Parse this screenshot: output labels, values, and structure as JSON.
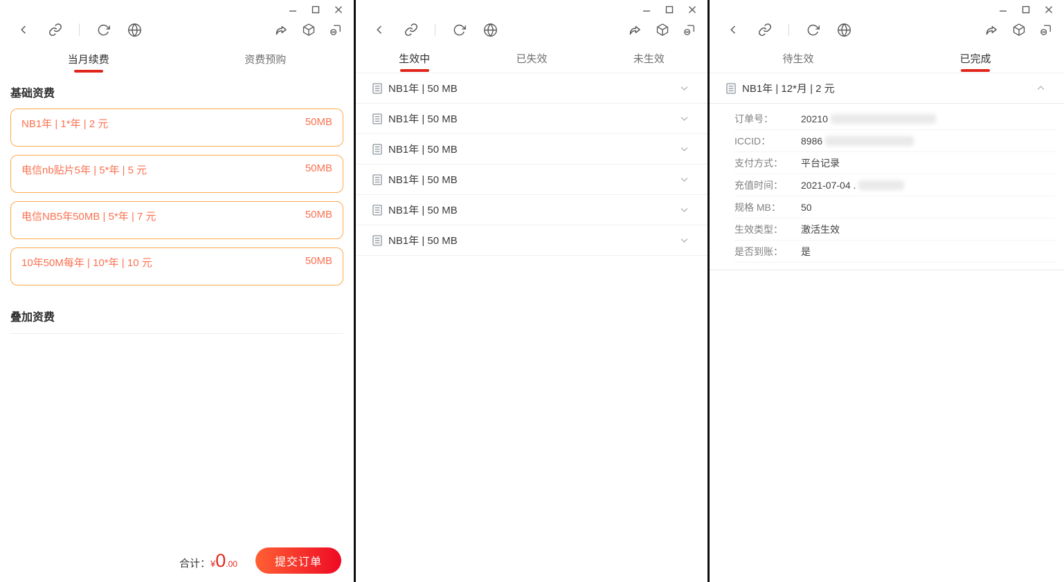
{
  "colors": {
    "accent_red": "#e1251b",
    "card_border": "#fba94c",
    "card_text": "#fb7150",
    "button_gradient": [
      "#ff6034",
      "#ee0a24"
    ]
  },
  "window1": {
    "tabs": [
      {
        "label": "当月续费",
        "active": true
      },
      {
        "label": "资费预购",
        "active": false
      }
    ],
    "basic_section_title": "基础资费",
    "addon_section_title": "叠加资费",
    "plans": [
      {
        "name": "NB1年 | 1*年 | 2 元",
        "size": "50MB"
      },
      {
        "name": "电信nb贴片5年 | 5*年 | 5 元",
        "size": "50MB"
      },
      {
        "name": "电信NB5年50MB | 5*年 | 7 元",
        "size": "50MB"
      },
      {
        "name": "10年50M每年 | 10*年 | 10 元",
        "size": "50MB"
      }
    ],
    "footer": {
      "total_label": "合计：",
      "currency": "¥",
      "amount_int": "0",
      "amount_dec": ".00",
      "submit_label": "提交订单"
    }
  },
  "window2": {
    "tabs": [
      {
        "label": "生效中",
        "active": true
      },
      {
        "label": "已失效",
        "active": false
      },
      {
        "label": "未生效",
        "active": false
      }
    ],
    "items": [
      "NB1年 | 50 MB",
      "NB1年 | 50 MB",
      "NB1年 | 50 MB",
      "NB1年 | 50 MB",
      "NB1年 | 50 MB",
      "NB1年 | 50 MB"
    ]
  },
  "window3": {
    "tabs": [
      {
        "label": "待生效",
        "active": false
      },
      {
        "label": "已完成",
        "active": true
      }
    ],
    "order": {
      "title": "NB1年 | 12*月 | 2 元",
      "details": [
        {
          "label": "订单号：",
          "value": "20210",
          "redacted": true
        },
        {
          "label": "ICCID：",
          "value": "8986",
          "redacted": true
        },
        {
          "label": "支付方式：",
          "value": "平台记录",
          "redacted": false
        },
        {
          "label": "充值时间：",
          "value": "2021-07-04 .",
          "redacted": true
        },
        {
          "label": "规格 MB：",
          "value": "50",
          "redacted": false
        },
        {
          "label": "生效类型：",
          "value": "激活生效",
          "redacted": false
        },
        {
          "label": "是否到账：",
          "value": "是",
          "redacted": false
        }
      ]
    }
  }
}
